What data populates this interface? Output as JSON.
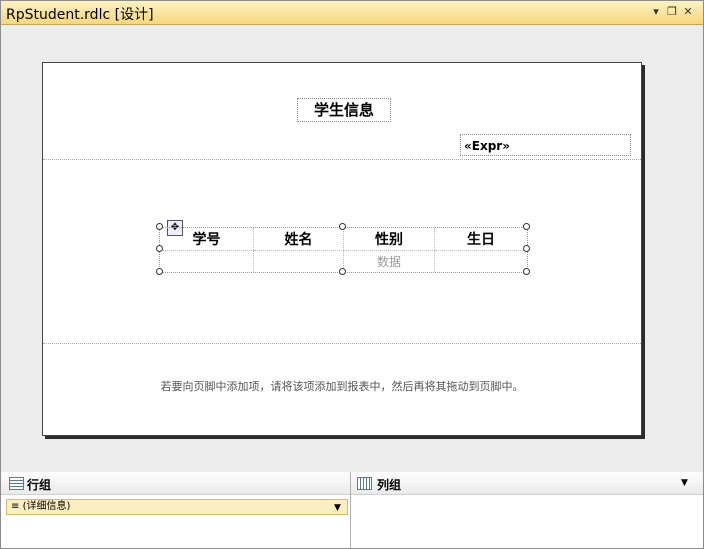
{
  "window": {
    "title": "RpStudent.rdlc [设计]",
    "controls": {
      "menu": "▾",
      "restore": "❐",
      "close": "✕"
    }
  },
  "report": {
    "title": "学生信息",
    "expression": "«Expr»",
    "table": {
      "headers": [
        "学号",
        "姓名",
        "性别",
        "生日"
      ],
      "data_placeholder": "数据"
    },
    "footer_hint": "若要向页脚中添加项，请将该项添加到报表中，然后再将其拖动到页脚中。"
  },
  "panels": {
    "row_groups": {
      "title": "行组",
      "item": "(详细信息)"
    },
    "column_groups": {
      "title": "列组"
    }
  }
}
